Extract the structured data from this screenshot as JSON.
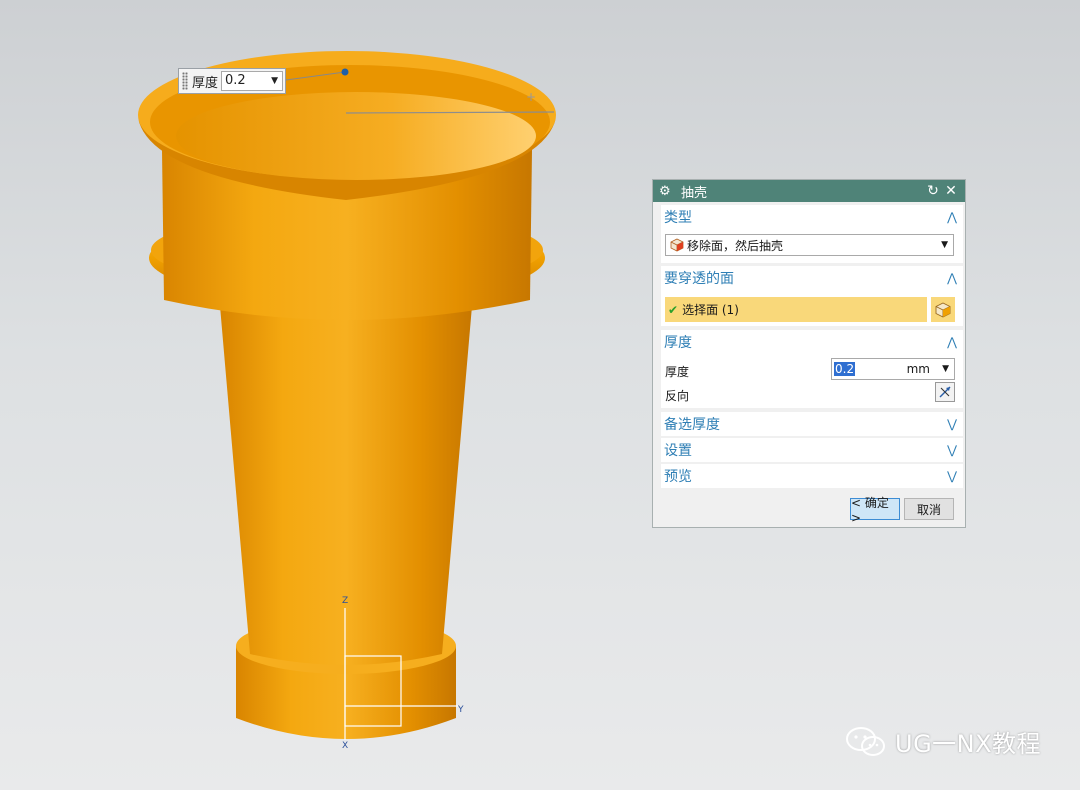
{
  "floating_input": {
    "label": "厚度",
    "value": "0.2"
  },
  "triad": {
    "z": "Z",
    "y": "Y",
    "x": "X"
  },
  "dialog": {
    "title": "抽壳",
    "sections": {
      "type": {
        "title": "类型",
        "selected": "移除面，然后抽壳"
      },
      "faces": {
        "title": "要穿透的面",
        "select_label": "选择面 (1)"
      },
      "thickness": {
        "title": "厚度",
        "thickness_label": "厚度",
        "value": "0.2",
        "unit": "mm",
        "reverse_label": "反向"
      },
      "alt_thickness": {
        "title": "备选厚度"
      },
      "settings": {
        "title": "设置"
      },
      "preview": {
        "title": "预览"
      }
    },
    "ok_label": "< 确定 >",
    "cancel_label": "取消"
  },
  "watermark": {
    "text": "UG一NX教程"
  },
  "colors": {
    "part": "#f0a000",
    "title_bar": "#4f8378",
    "section_title": "#2f7fb5",
    "selection": "#f9d87a"
  }
}
